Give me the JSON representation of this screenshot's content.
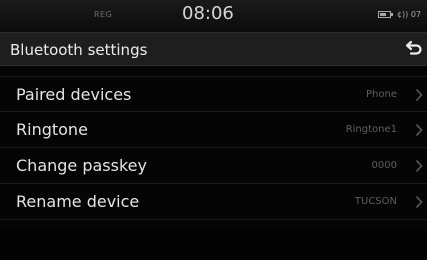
{
  "status_bar": {
    "left_text": "REG",
    "time": "08:06",
    "right_text": "¢)) 07"
  },
  "header": {
    "title": "Bluetooth settings",
    "back_icon": "back-arrow-icon"
  },
  "menu": {
    "items": [
      {
        "label": "Paired devices",
        "value": "Phone"
      },
      {
        "label": "Ringtone",
        "value": "Ringtone1"
      },
      {
        "label": "Change passkey",
        "value": "0000"
      },
      {
        "label": "Rename device",
        "value": "TUCSON"
      }
    ]
  },
  "colors": {
    "background": "#050505",
    "header": "#1e1e1e",
    "text": "#e4e4e4",
    "value_text": "#5e5e5e"
  }
}
